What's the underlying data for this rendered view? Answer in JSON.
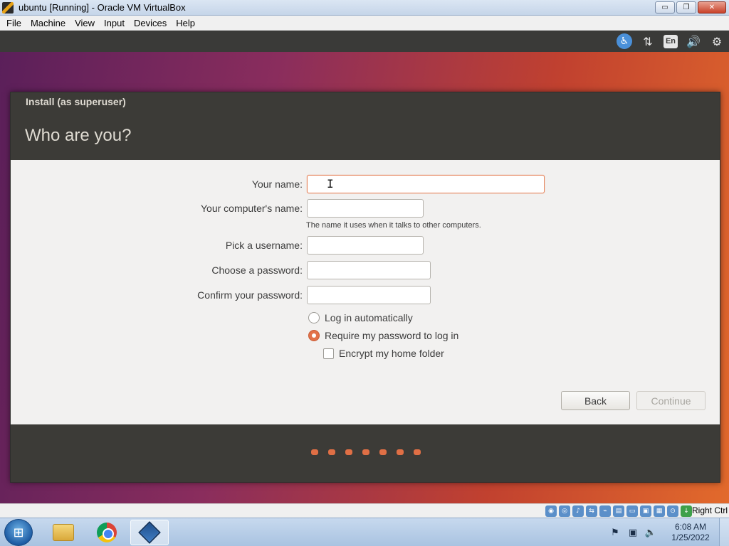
{
  "window": {
    "title": "ubuntu [Running] - Oracle VM VirtualBox",
    "minimize_glyph": "▭",
    "restore_glyph": "❐",
    "close_glyph": "✕"
  },
  "menubar": {
    "items": [
      "File",
      "Machine",
      "View",
      "Input",
      "Devices",
      "Help"
    ]
  },
  "guest_panel": {
    "language": "En",
    "icons": [
      "accessibility-icon",
      "network-icon",
      "keyboard-language-icon",
      "volume-icon",
      "settings-icon"
    ]
  },
  "installer": {
    "window_title": "Install (as superuser)",
    "heading": "Who are you?",
    "fields": {
      "your_name": {
        "label": "Your name:",
        "value": ""
      },
      "computer_name": {
        "label": "Your computer's name:",
        "value": "",
        "hint": "The name it uses when it talks to other computers."
      },
      "username": {
        "label": "Pick a username:",
        "value": ""
      },
      "password": {
        "label": "Choose a password:",
        "value": ""
      },
      "confirm_password": {
        "label": "Confirm your password:",
        "value": ""
      }
    },
    "options": {
      "login_auto": {
        "label": "Log in automatically",
        "checked": false
      },
      "require_password": {
        "label": "Require my password to log in",
        "checked": true
      },
      "encrypt_home": {
        "label": "Encrypt my home folder",
        "checked": false
      }
    },
    "buttons": {
      "back": "Back",
      "continue": "Continue"
    },
    "progress_dots": 7
  },
  "vb_statusbar": {
    "host_key": "Right Ctrl"
  },
  "taskbar": {
    "apps": [
      "windows-explorer",
      "google-chrome",
      "virtualbox"
    ],
    "active_app": "virtualbox",
    "clock": {
      "time": "6:08 AM",
      "date": "1/25/2022"
    }
  },
  "colors": {
    "accent": "#e2724a",
    "installer_header": "#3c3b37",
    "installer_body": "#f2f1f0",
    "focus_border": "#e6865f"
  }
}
